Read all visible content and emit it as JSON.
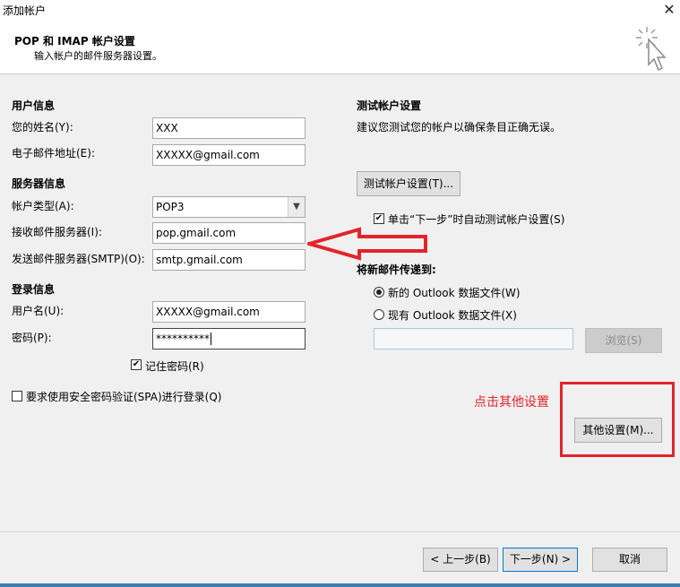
{
  "window": {
    "title": "添加帐户",
    "close_glyph": "✕"
  },
  "header": {
    "title": "POP 和 IMAP 帐户设置",
    "subtitle": "输入帐户的邮件服务器设置。",
    "icon": "wizard-cursor-icon"
  },
  "user_info": {
    "section": "用户信息",
    "name_label": "您的姓名(Y):",
    "name_value": "XXX",
    "email_label": "电子邮件地址(E):",
    "email_value": "XXXXX@gmail.com"
  },
  "server_info": {
    "section": "服务器信息",
    "account_type_label": "帐户类型(A):",
    "account_type_value": "POP3",
    "incoming_label": "接收邮件服务器(I):",
    "incoming_value": "pop.gmail.com",
    "outgoing_label": "发送邮件服务器(SMTP)(O):",
    "outgoing_value": "smtp.gmail.com"
  },
  "login_info": {
    "section": "登录信息",
    "username_label": "用户名(U):",
    "username_value": "XXXXX@gmail.com",
    "password_label": "密码(P):",
    "password_value": "**********",
    "remember_label": "记住密码(R)",
    "remember_checked": true,
    "spa_label": "要求使用安全密码验证(SPA)进行登录(Q)",
    "spa_checked": false
  },
  "test_settings": {
    "section": "测试帐户设置",
    "description": "建议您测试您的帐户以确保条目正确无误。",
    "test_button": "测试帐户设置(T)...",
    "auto_test_label": "单击“下一步”时自动测试帐户设置(S)",
    "auto_test_checked": true
  },
  "deliver_to": {
    "section": "将新邮件传递到:",
    "option_new": "新的 Outlook 数据文件(W)",
    "option_existing": "现有 Outlook 数据文件(X)",
    "selected": "new",
    "existing_path": "",
    "browse_button": "浏览(S)"
  },
  "more_settings_button": "其他设置(M)...",
  "annotation": {
    "text": "点击其他设置",
    "color": "#e3242b"
  },
  "footer": {
    "back": "< 上一步(B)",
    "next": "下一步(N) >",
    "cancel": "取消"
  }
}
